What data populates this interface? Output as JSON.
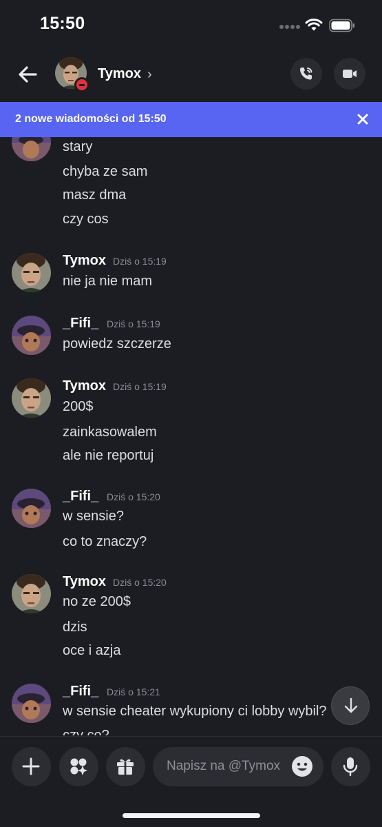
{
  "status_bar": {
    "time": "15:50"
  },
  "header": {
    "username": "Tymox",
    "chevron": "›"
  },
  "banner": {
    "text": "2 nowe wiadomości od 15:50"
  },
  "messages": [
    {
      "author": "",
      "time": "",
      "lines": [
        "stary",
        "chyba ze sam",
        "masz dma",
        "czy cos"
      ]
    },
    {
      "author": "Tymox",
      "time": "Dziś o 15:19",
      "lines": [
        "nie ja nie mam"
      ]
    },
    {
      "author": "_Fifi_",
      "time": "Dziś o 15:19",
      "lines": [
        "powiedz szczerze"
      ]
    },
    {
      "author": "Tymox",
      "time": "Dziś o 15:19",
      "lines": [
        "200$",
        "zainkasowalem",
        "ale nie reportuj"
      ]
    },
    {
      "author": "_Fifi_",
      "time": "Dziś o 15:20",
      "lines": [
        "w sensie?",
        "co to znaczy?"
      ]
    },
    {
      "author": "Tymox",
      "time": "Dziś o 15:20",
      "lines": [
        "no ze 200$",
        "dzis",
        "oce i azja"
      ]
    },
    {
      "author": "_Fifi_",
      "time": "Dziś o 15:21",
      "lines": [
        "w sensie cheater wykupiony ci lobby wybil?",
        "czy co?"
      ]
    }
  ],
  "input": {
    "placeholder": "Napisz na @Tymox"
  },
  "icons": {
    "back": "arrow-left-icon",
    "call": "phone-call-icon",
    "video": "video-camera-icon",
    "close": "close-icon",
    "add": "plus-icon",
    "apps": "apps-icon",
    "gift": "gift-icon",
    "emoji": "emoji-icon",
    "mic": "microphone-icon",
    "scroll": "arrow-down-icon"
  },
  "colors": {
    "accent": "#5865f2",
    "background": "#1c1d22",
    "dnd": "#e0323c"
  }
}
